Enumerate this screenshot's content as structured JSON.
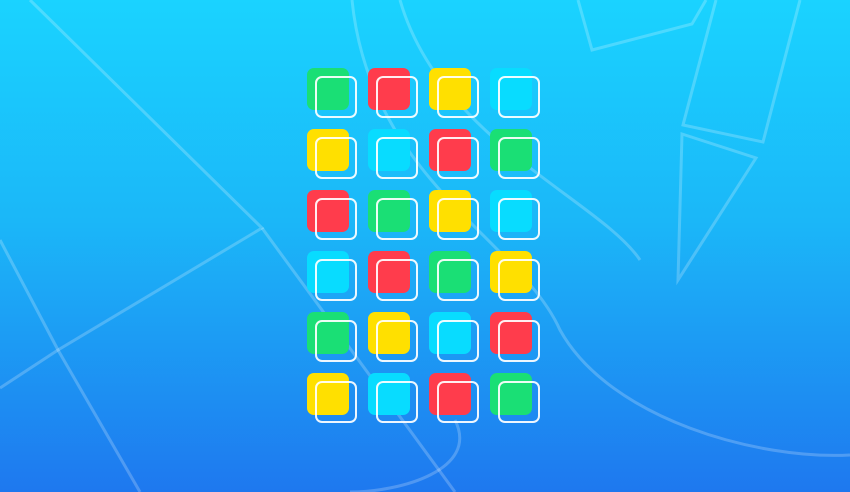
{
  "game": {
    "colors": {
      "green": "#1adf75",
      "red": "#ff3c4c",
      "yellow": "#ffe000",
      "cyan": "#08dcff"
    },
    "background": {
      "top": "#1ad3ff",
      "bottom": "#1e78ef",
      "line_color": "rgba(255,255,255,0.22)"
    },
    "board": {
      "rows": 6,
      "cols": 4,
      "tiles": [
        [
          "green",
          "red",
          "yellow",
          "cyan"
        ],
        [
          "yellow",
          "cyan",
          "red",
          "green"
        ],
        [
          "red",
          "green",
          "yellow",
          "cyan"
        ],
        [
          "cyan",
          "red",
          "green",
          "yellow"
        ],
        [
          "green",
          "yellow",
          "cyan",
          "red"
        ],
        [
          "yellow",
          "cyan",
          "red",
          "green"
        ]
      ]
    }
  }
}
